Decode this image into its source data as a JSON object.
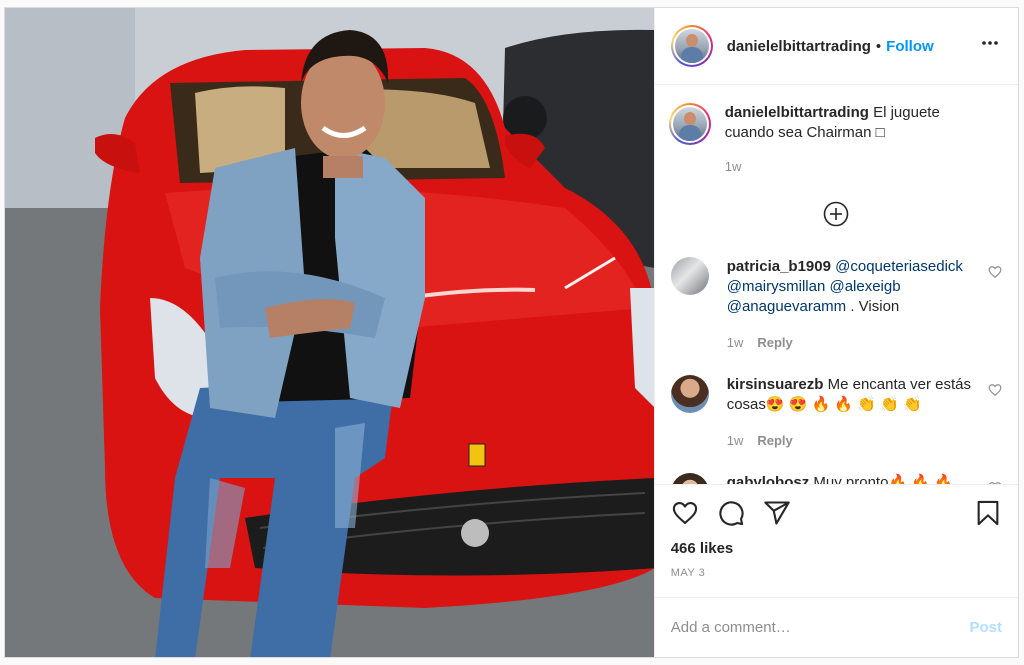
{
  "header": {
    "username": "danielelbittartrading",
    "separator": "•",
    "follow_label": "Follow",
    "more_icon": "more-horizontal-icon"
  },
  "caption": {
    "username": "danielelbittartrading",
    "text": "El juguete cuando sea Chairman □",
    "time": "1w"
  },
  "load_more_icon": "plus-circle-icon",
  "comments": [
    {
      "username": "patricia_b1909",
      "mentions": [
        "@coqueteriasedick",
        "@mairysmillan",
        "@alexeigb",
        "@anaguevaramm"
      ],
      "text_after": ". Vision",
      "time": "1w",
      "reply_label": "Reply"
    },
    {
      "username": "kirsinsuarezb",
      "text": "Me encanta ver estás cosas😍 😍 🔥 🔥 👏 👏 👏",
      "time": "1w",
      "reply_label": "Reply"
    },
    {
      "username": "gabylobosz",
      "text": "Muy pronto🔥 🔥 🔥"
    }
  ],
  "actions": {
    "like_icon": "heart-icon",
    "comment_icon": "comment-icon",
    "share_icon": "share-icon",
    "save_icon": "bookmark-icon"
  },
  "likes": "466 likes",
  "date": "MAY 3",
  "add_comment": {
    "placeholder": "Add a comment…",
    "post_label": "Post"
  },
  "colors": {
    "link": "#0095f6",
    "post_disabled": "#b2dffc",
    "mention": "#00376b",
    "muted": "#8e8e8e"
  }
}
